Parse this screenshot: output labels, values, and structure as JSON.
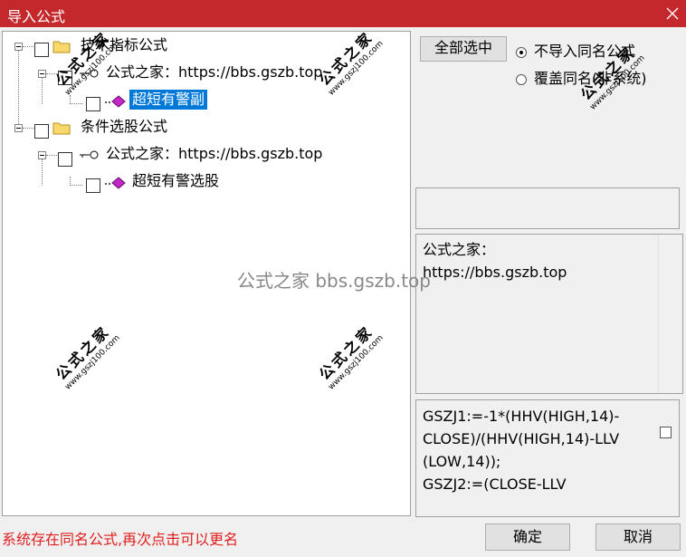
{
  "window": {
    "title": "导入公式"
  },
  "tree": {
    "nodes": [
      {
        "label": "技术指标公式",
        "type": "folder"
      },
      {
        "label": "公式之家：https://bbs.gszb.top",
        "type": "key"
      },
      {
        "label": "超短有警副",
        "type": "formula",
        "selected": true
      },
      {
        "label": "条件选股公式",
        "type": "folder"
      },
      {
        "label": "公式之家：https://bbs.gszb.top",
        "type": "key"
      },
      {
        "label": "超短有警选股",
        "type": "formula"
      }
    ]
  },
  "watermark": {
    "title": "公式之家",
    "url": "www.gszj100.com",
    "center": "公式之家 bbs.gszb.top"
  },
  "controls": {
    "select_all": "全部选中",
    "radio_skip": "不导入同名公式",
    "radio_overwrite": "覆盖同名(非系统)"
  },
  "description": "公式之家：\nhttps://bbs.gszb.top",
  "code_lines": [
    "GSZJ1:=-1*(HHV(HIGH,14)-",
    "CLOSE)/(HHV(HIGH,14)-LLV",
    "(LOW,14));",
    "GSZJ2:=(CLOSE-LLV"
  ],
  "status": "系统存在同名公式,再次点击可以更名",
  "buttons": {
    "ok": "确定",
    "cancel": "取消"
  },
  "colors": {
    "titlebar": "#c4282c",
    "selection": "#0078d7",
    "status": "#e02020"
  }
}
